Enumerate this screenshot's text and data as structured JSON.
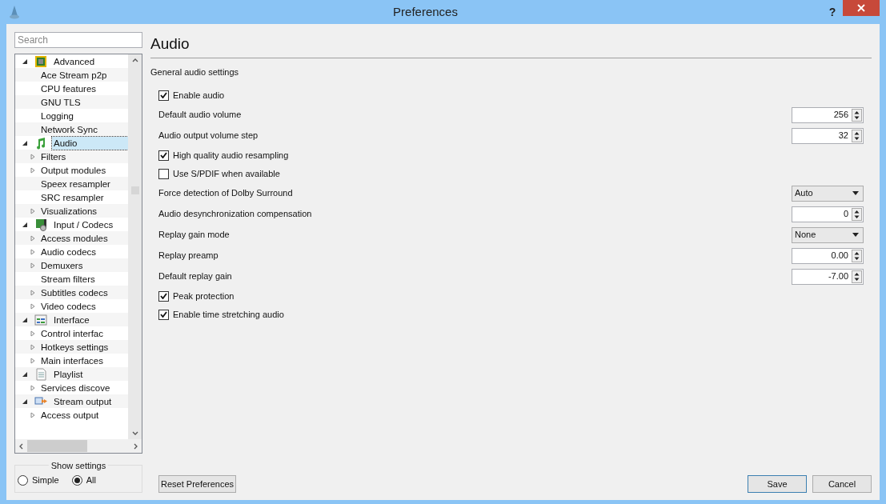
{
  "window": {
    "title": "Preferences",
    "help": "?"
  },
  "search": {
    "placeholder": "Search"
  },
  "tree": [
    {
      "label": "Advanced",
      "expanded": true,
      "selected": false,
      "children": [
        {
          "label": "Ace Stream p2p",
          "expandable": false,
          "selected": false
        },
        {
          "label": "CPU features",
          "expandable": false,
          "selected": false
        },
        {
          "label": "GNU TLS",
          "expandable": false,
          "selected": false
        },
        {
          "label": "Logging",
          "expandable": false,
          "selected": false
        },
        {
          "label": "Network Sync",
          "expandable": false,
          "selected": false
        }
      ]
    },
    {
      "label": "Audio",
      "expanded": true,
      "selected": true,
      "children": [
        {
          "label": "Filters",
          "expandable": true,
          "selected": false
        },
        {
          "label": "Output modules",
          "expandable": true,
          "selected": false
        },
        {
          "label": "Speex resampler",
          "expandable": false,
          "selected": false
        },
        {
          "label": "SRC resampler",
          "expandable": false,
          "selected": false
        },
        {
          "label": "Visualizations",
          "expandable": true,
          "selected": false
        }
      ]
    },
    {
      "label": "Input / Codecs",
      "expanded": true,
      "selected": false,
      "children": [
        {
          "label": "Access modules",
          "expandable": true,
          "selected": false
        },
        {
          "label": "Audio codecs",
          "expandable": true,
          "selected": false
        },
        {
          "label": "Demuxers",
          "expandable": true,
          "selected": false
        },
        {
          "label": "Stream filters",
          "expandable": false,
          "selected": false
        },
        {
          "label": "Subtitles codecs",
          "expandable": true,
          "selected": false
        },
        {
          "label": "Video codecs",
          "expandable": true,
          "selected": false
        }
      ]
    },
    {
      "label": "Interface",
      "expanded": true,
      "selected": false,
      "children": [
        {
          "label": "Control interfac",
          "expandable": true,
          "selected": false
        },
        {
          "label": "Hotkeys settings",
          "expandable": true,
          "selected": false
        },
        {
          "label": "Main interfaces",
          "expandable": true,
          "selected": false
        }
      ]
    },
    {
      "label": "Playlist",
      "expanded": true,
      "selected": false,
      "children": [
        {
          "label": "Services discove",
          "expandable": true,
          "selected": false
        }
      ]
    },
    {
      "label": "Stream output",
      "expanded": true,
      "selected": false,
      "children": [
        {
          "label": "Access output",
          "expandable": true,
          "selected": false
        }
      ]
    }
  ],
  "show_settings": {
    "title": "Show settings",
    "options": [
      {
        "label": "Simple",
        "selected": false
      },
      {
        "label": "All",
        "selected": true
      }
    ]
  },
  "panel": {
    "title": "Audio",
    "section": "General audio settings"
  },
  "settings": [
    {
      "kind": "checkbox",
      "label": "Enable audio",
      "checked": true
    },
    {
      "kind": "spin",
      "label": "Default audio volume",
      "value": "256"
    },
    {
      "kind": "spin",
      "label": "Audio output volume step",
      "value": "32"
    },
    {
      "kind": "checkbox",
      "label": "High quality audio resampling",
      "checked": true
    },
    {
      "kind": "checkbox",
      "label": "Use S/PDIF when available",
      "checked": false
    },
    {
      "kind": "combo",
      "label": "Force detection of Dolby Surround",
      "value": "Auto"
    },
    {
      "kind": "spin",
      "label": "Audio desynchronization compensation",
      "value": "0"
    },
    {
      "kind": "combo",
      "label": "Replay gain mode",
      "value": "None"
    },
    {
      "kind": "spin",
      "label": "Replay preamp",
      "value": "0.00"
    },
    {
      "kind": "spin",
      "label": "Default replay gain",
      "value": "-7.00"
    },
    {
      "kind": "checkbox",
      "label": "Peak protection",
      "checked": true
    },
    {
      "kind": "checkbox",
      "label": "Enable time stretching audio",
      "checked": true
    }
  ],
  "buttons": {
    "reset": "Reset Preferences",
    "save": "Save",
    "cancel": "Cancel"
  }
}
